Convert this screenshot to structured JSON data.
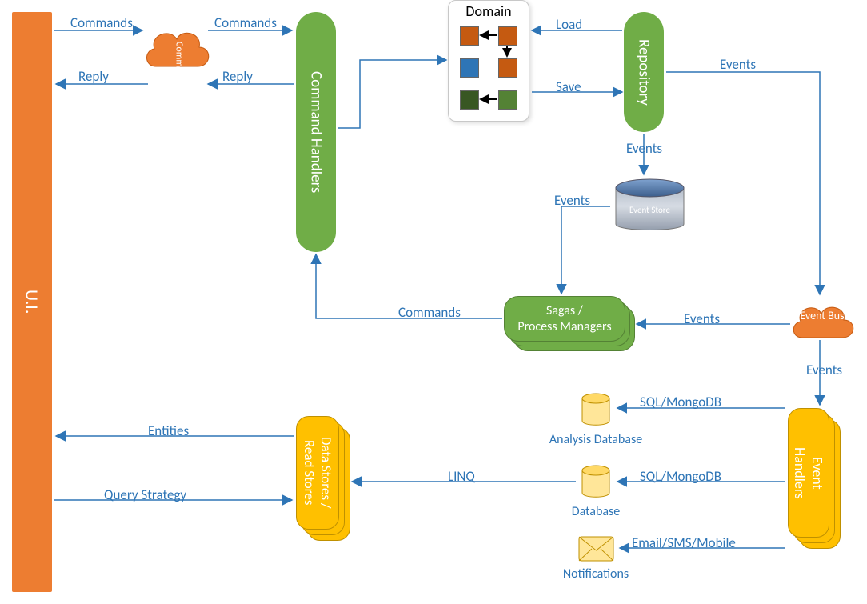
{
  "nodes": {
    "ui": "U.I.",
    "command_bus": "Command\nBus",
    "command_handlers": "Command Handlers",
    "domain_title": "Domain",
    "repository": "Repository",
    "event_store": "Event Store",
    "sagas": "Sagas /\nProcess Managers",
    "event_bus": "Event\nBus",
    "event_handlers": "Event\nHandlers",
    "data_stores": "Data Stores /\nRead Stores",
    "analysis_db": "Analysis Database",
    "database": "Database",
    "notifications": "Notifications"
  },
  "edges": {
    "commands1": "Commands",
    "reply1": "Reply",
    "commands2": "Commands",
    "reply2": "Reply",
    "load": "Load",
    "save": "Save",
    "events_repo_out": "Events",
    "events_repo_down": "Events",
    "events_store_out": "Events",
    "events_bus_sagas": "Events",
    "events_bus_down": "Events",
    "commands_sagas": "Commands",
    "sql1": "SQL/MongoDB",
    "sql2": "SQL/MongoDB",
    "email": "Email/SMS/Mobile",
    "linq": "LINQ",
    "entities": "Entities",
    "query_strategy": "Query Strategy"
  }
}
